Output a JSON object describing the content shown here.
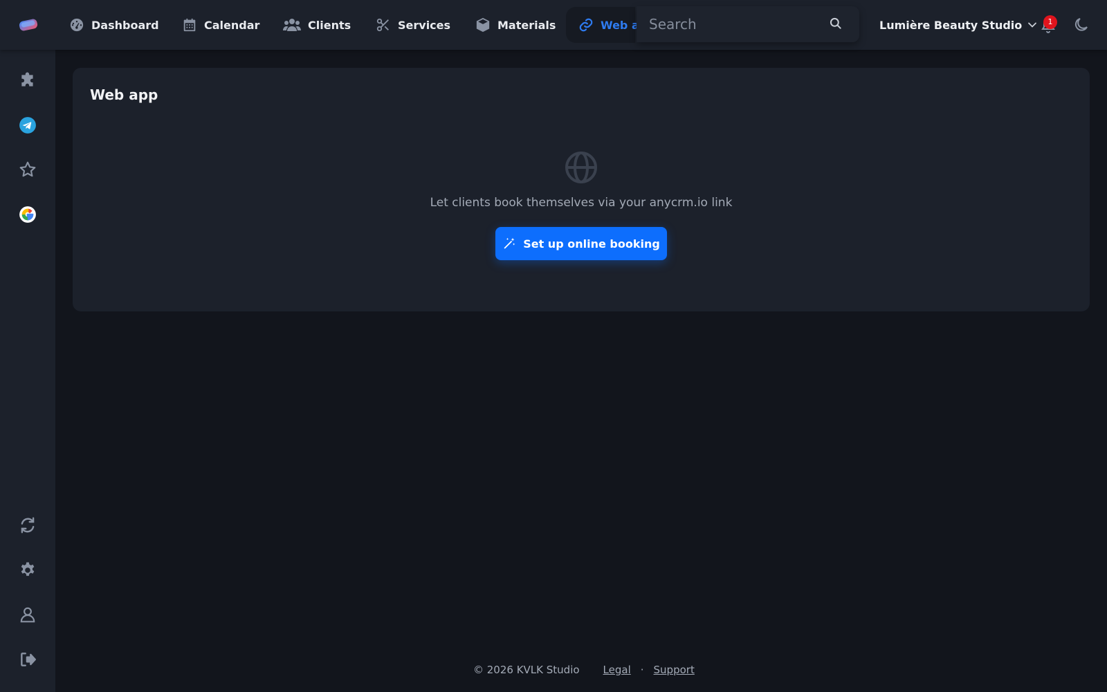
{
  "nav": {
    "items": [
      {
        "label": "Dashboard"
      },
      {
        "label": "Calendar"
      },
      {
        "label": "Clients"
      },
      {
        "label": "Services"
      },
      {
        "label": "Materials"
      },
      {
        "label": "Web a"
      }
    ]
  },
  "search": {
    "placeholder": "Search"
  },
  "account": {
    "studio_name": "Lumière Beauty Studio"
  },
  "notifications": {
    "count": "1"
  },
  "card": {
    "title": "Web app",
    "empty_text": "Let clients book themselves via your anycrm.io link",
    "cta_label": "Set up online booking"
  },
  "footer": {
    "copyright": "© 2026 KVLK Studio",
    "legal": "Legal",
    "dot": "·",
    "support": "Support"
  },
  "colors": {
    "accent": "#0d6efd",
    "active_nav": "#2e7bf0",
    "badge": "#e0141d",
    "background": "#12151c",
    "surface": "#1c212b"
  }
}
